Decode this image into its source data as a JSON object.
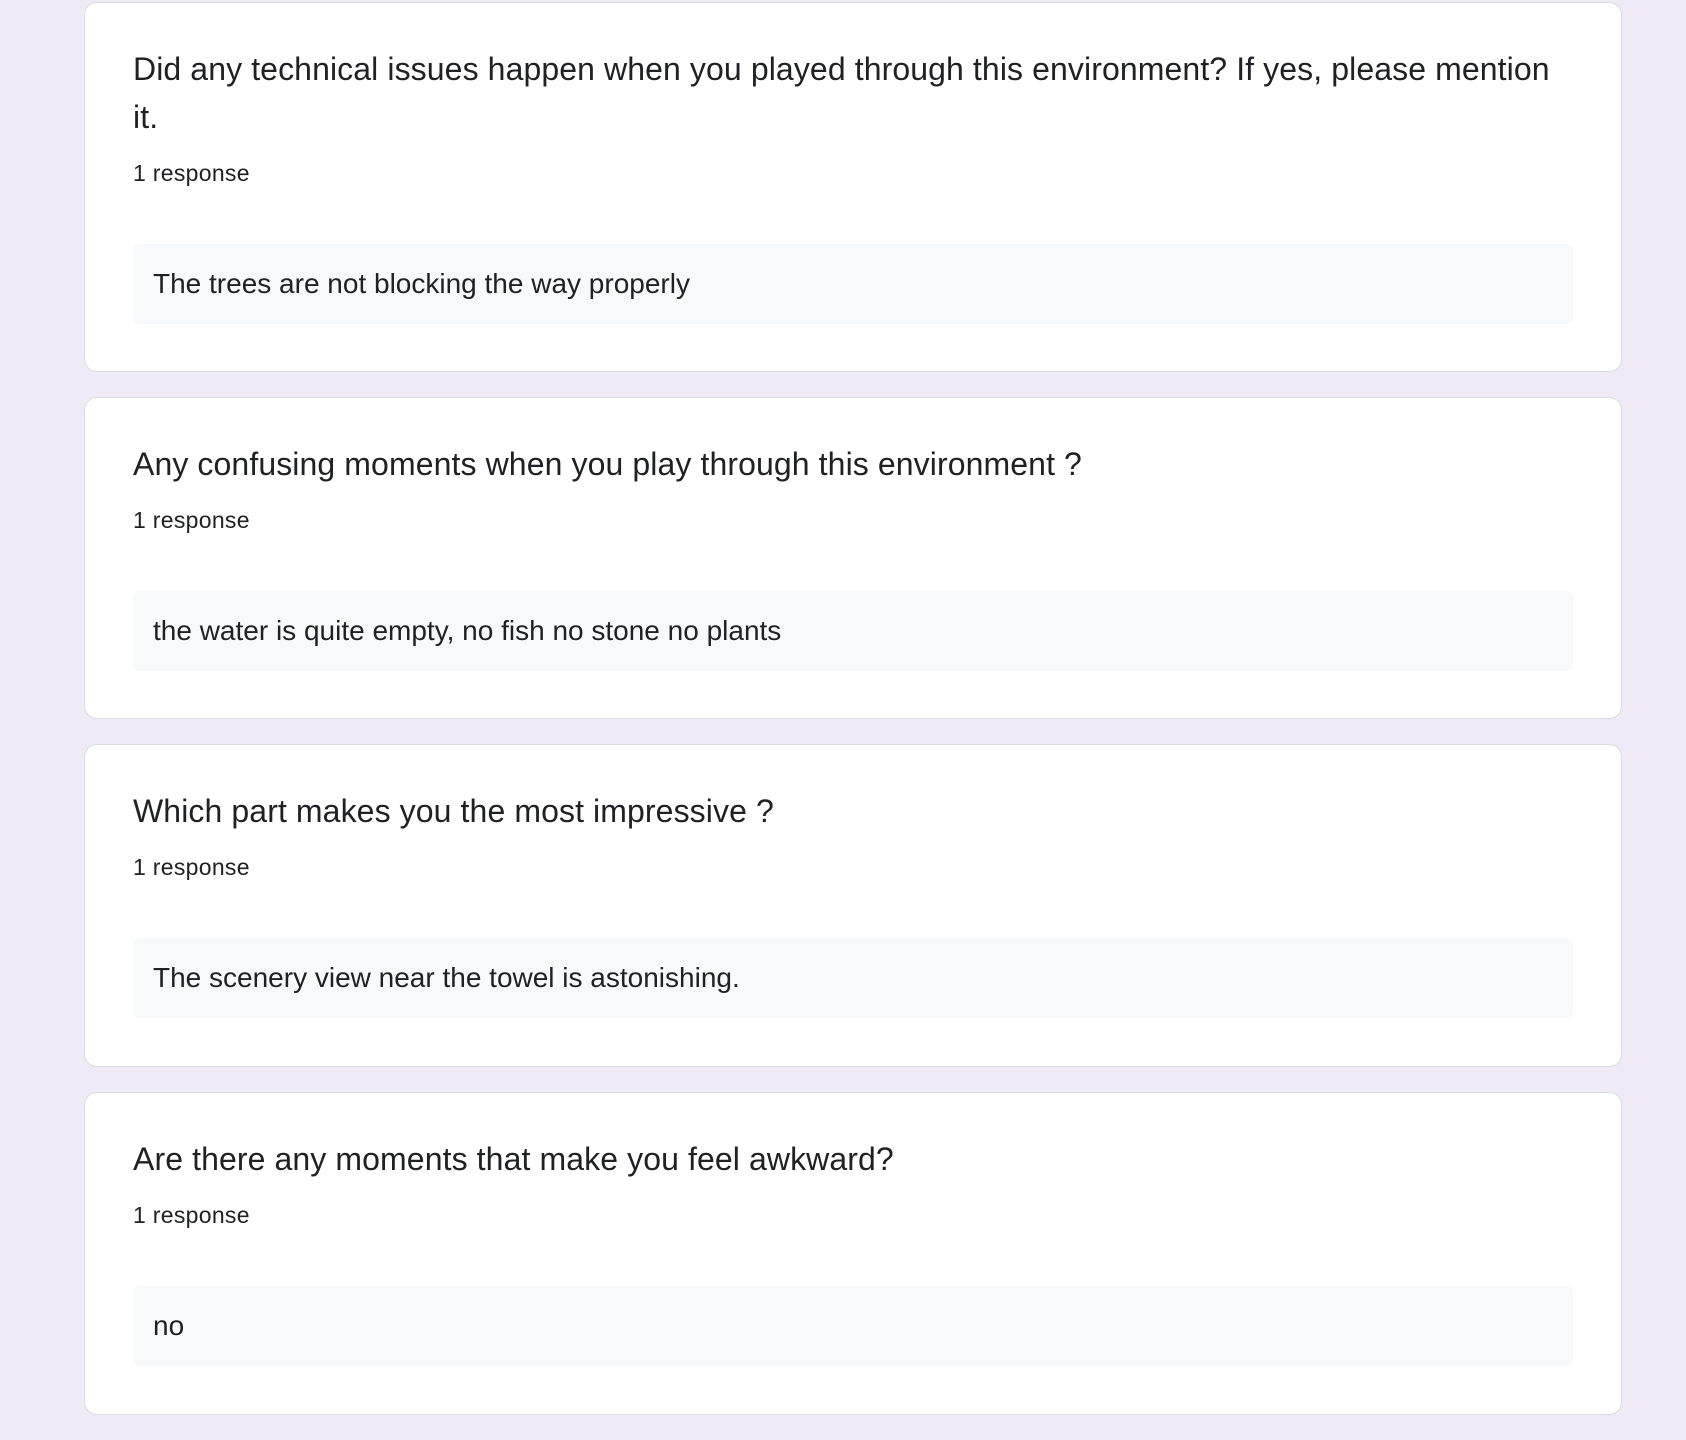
{
  "colors": {
    "page_background": "#efebf6",
    "card_background": "#ffffff",
    "card_border": "#dadce0",
    "answer_background": "#f8f9fa",
    "text": "#202124"
  },
  "questions": [
    {
      "title": "Did any technical issues happen when you played through this environment? If yes, please mention it.",
      "response_count": "1 response",
      "responses": [
        "The trees are not blocking the way properly"
      ]
    },
    {
      "title": "Any confusing moments when you play through this environment ?",
      "response_count": "1 response",
      "responses": [
        "the water is quite empty, no fish no stone no plants"
      ]
    },
    {
      "title": "Which part makes you the most impressive ?",
      "response_count": "1 response",
      "responses": [
        "The scenery view near the towel is astonishing."
      ]
    },
    {
      "title": "Are there any moments that make you feel awkward?",
      "response_count": "1 response",
      "responses": [
        "no"
      ]
    }
  ]
}
